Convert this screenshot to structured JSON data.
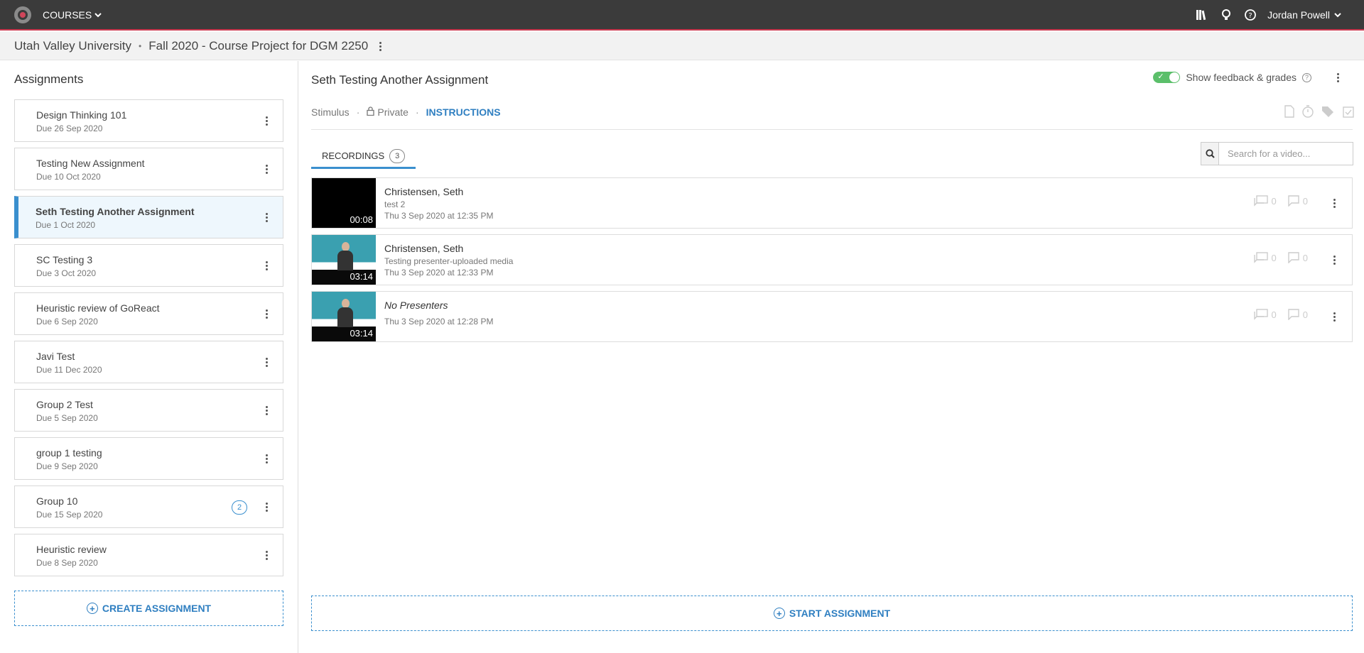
{
  "topbar": {
    "courses_label": "COURSES",
    "user_name": "Jordan Powell"
  },
  "breadcrumb": {
    "institution": "Utah Valley University",
    "separator": "•",
    "course": "Fall 2020 - Course Project for DGM 2250"
  },
  "sidebar": {
    "heading": "Assignments",
    "items": [
      {
        "title": "Design Thinking 101",
        "due": "Due 26 Sep 2020"
      },
      {
        "title": "Testing New Assignment",
        "due": "Due 10 Oct 2020"
      },
      {
        "title": "Seth Testing Another Assignment",
        "due": "Due 1 Oct 2020"
      },
      {
        "title": "SC Testing 3",
        "due": "Due 3 Oct 2020"
      },
      {
        "title": "Heuristic review of GoReact",
        "due": "Due 6 Sep 2020"
      },
      {
        "title": "Javi Test",
        "due": "Due 11 Dec 2020"
      },
      {
        "title": "Group 2 Test",
        "due": "Due 5 Sep 2020"
      },
      {
        "title": "group 1 testing",
        "due": "Due 9 Sep 2020"
      },
      {
        "title": "Group 10",
        "due": "Due 15 Sep 2020",
        "count": "2"
      },
      {
        "title": "Heuristic review",
        "due": "Due 8 Sep 2020"
      }
    ],
    "create_label": "CREATE ASSIGNMENT"
  },
  "main": {
    "title": "Seth Testing Another Assignment",
    "toggle_label": "Show feedback & grades",
    "meta": {
      "stimulus": "Stimulus",
      "privacy": "Private",
      "instructions": "INSTRUCTIONS",
      "separator": "·"
    },
    "tab": {
      "label": "RECORDINGS",
      "count": "3"
    },
    "search_placeholder": "Search for a video...",
    "recordings": [
      {
        "name": "Christensen, Seth",
        "note": "test 2",
        "date": "Thu 3 Sep 2020 at 12:35 PM",
        "duration": "00:08",
        "comments": "0",
        "replies": "0"
      },
      {
        "name": "Christensen, Seth",
        "note": "Testing presenter-uploaded media",
        "date": "Thu 3 Sep 2020 at 12:33 PM",
        "duration": "03:14",
        "comments": "0",
        "replies": "0"
      },
      {
        "name": "No Presenters",
        "date": "Thu 3 Sep 2020 at 12:28 PM",
        "duration": "03:14",
        "comments": "0",
        "replies": "0"
      }
    ],
    "start_label": "START ASSIGNMENT"
  },
  "colors": {
    "accent": "#3a8fce",
    "topbar": "#3b3b3b",
    "brand_red": "#c8374d",
    "toggle_on": "#5bbf6a"
  }
}
